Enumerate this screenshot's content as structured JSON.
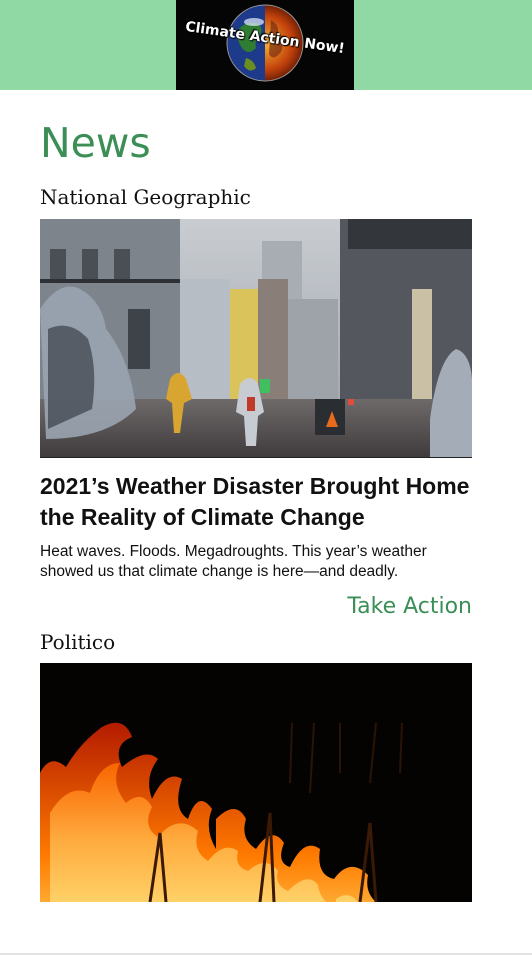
{
  "header": {
    "logo_text": "Climate Action Now!",
    "logo_icon": "globe-half-fire-icon",
    "background_color": "#90d9a5"
  },
  "page": {
    "title": "News",
    "accent_color": "#3b8f56"
  },
  "articles": [
    {
      "source": "National Geographic",
      "image": "flooded-street-rain-photo",
      "headline": "2021’s Weather Disaster Brought Home the Reality of Climate Change",
      "summary": "Heat waves. Floods. Megadroughts. This year’s weather showed us that climate change is here—and deadly.",
      "action_label": "Take Action"
    },
    {
      "source": "Politico",
      "image": "wildfire-flames-photo"
    }
  ]
}
